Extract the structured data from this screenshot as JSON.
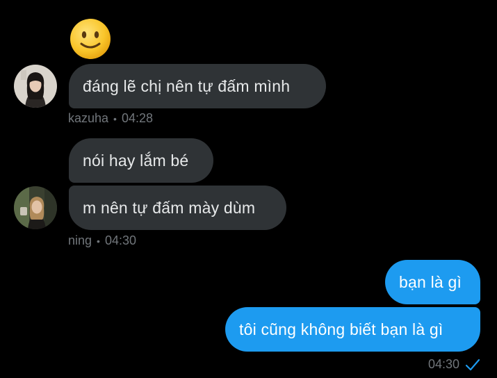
{
  "conversation": {
    "reaction_emoji": "slightly-smiling-face",
    "messages": [
      {
        "sender": "kazuha",
        "direction": "incoming",
        "text": "đáng lẽ chị nên tự đấm mình"
      },
      {
        "sender": "ning",
        "direction": "incoming",
        "text": "nói hay lắm bé"
      },
      {
        "sender": "ning",
        "direction": "incoming",
        "text": "m nên tự đấm mày dùm"
      },
      {
        "sender": "me",
        "direction": "outgoing",
        "text": "bạn là gì"
      },
      {
        "sender": "me",
        "direction": "outgoing",
        "text": "tôi cũng không biết bạn là gì"
      }
    ],
    "meta": {
      "kazuha": {
        "name": "kazuha",
        "separator": "•",
        "time": "04:28"
      },
      "ning": {
        "name": "ning",
        "separator": "•",
        "time": "04:30"
      },
      "me": {
        "time": "04:30",
        "status_icon": "sent-check-icon"
      }
    }
  },
  "colors": {
    "background": "#000000",
    "incoming_bubble": "#2f3336",
    "outgoing_bubble": "#1d9bf0",
    "meta_text": "#71767b",
    "check_icon": "#1d9bf0"
  }
}
